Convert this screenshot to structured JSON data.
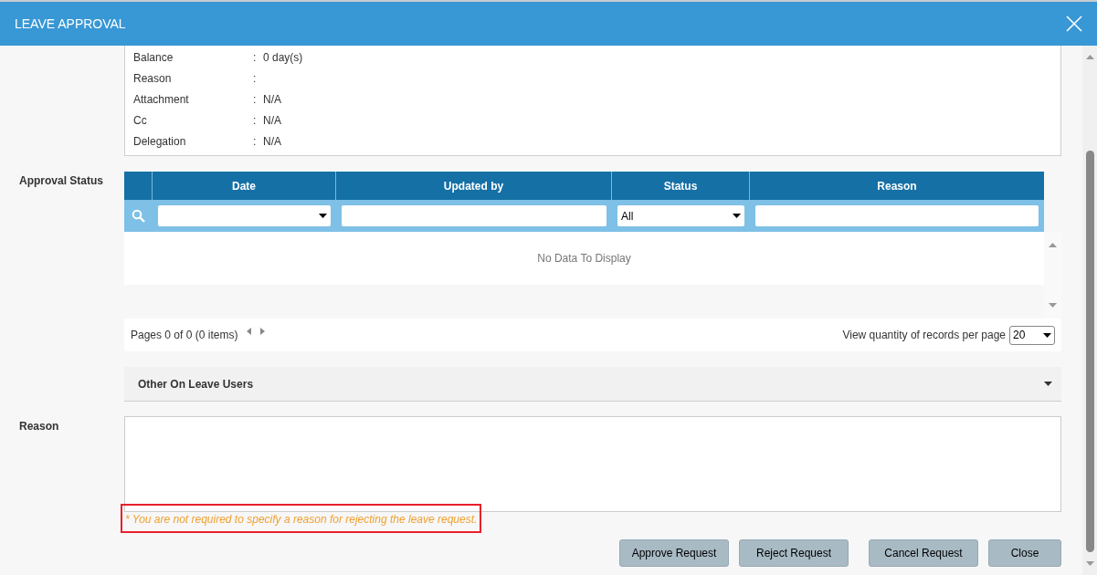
{
  "window": {
    "title": "LEAVE APPROVAL"
  },
  "details": [
    {
      "label": "Balance",
      "separator": ":",
      "value": "0 day(s)"
    },
    {
      "label": "Reason",
      "separator": ":"
    },
    {
      "label": "Attachment",
      "separator": ":",
      "value": "N/A"
    },
    {
      "label": "Cc",
      "separator": ":",
      "value": "N/A"
    },
    {
      "label": "Delegation",
      "separator": ":",
      "value": "N/A"
    }
  ],
  "approval_status": {
    "label": "Approval Status",
    "columns": [
      "Date",
      "Updated by",
      "Status",
      "Reason"
    ],
    "filters": [
      {
        "kind": "dropdown"
      },
      {
        "kind": "text"
      },
      {
        "kind": "dropdown",
        "value": "All"
      },
      {
        "kind": "text"
      }
    ],
    "empty_message": "No Data To Display",
    "pager": {
      "info": "Pages 0 of 0 (0 items)",
      "per_page_label": "View quantity of records per page",
      "per_page_value": "20"
    }
  },
  "other_users": {
    "title": "Other On Leave Users",
    "expanded": false
  },
  "reason": {
    "label": "Reason",
    "note": "* You are not required to specify a reason for rejecting the leave request."
  },
  "buttons": [
    "Approve Request",
    "Reject Request",
    "Cancel Request",
    "Close"
  ]
}
